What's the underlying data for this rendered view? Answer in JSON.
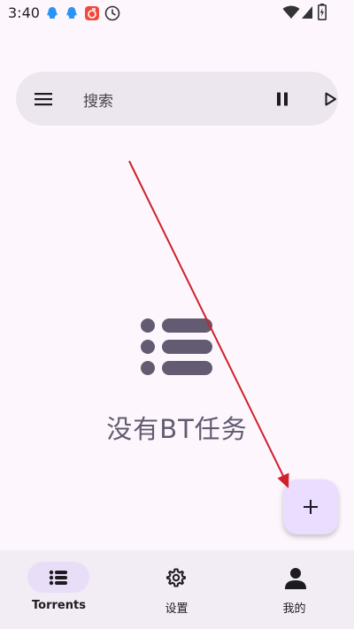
{
  "status_bar": {
    "time": "3:40",
    "notification_icons": [
      "qq-icon",
      "qq-icon",
      "music-app-icon",
      "clock-app-icon"
    ],
    "system_icons": [
      "wifi-icon",
      "signal-icon",
      "battery-icon"
    ]
  },
  "search_bar": {
    "placeholder": "搜索",
    "actions": [
      "pause-all",
      "resume-all"
    ]
  },
  "empty_state": {
    "message": "没有BT任务"
  },
  "fab": {
    "icon": "plus-icon"
  },
  "bottom_nav": {
    "items": [
      {
        "label": "Torrents",
        "icon": "list-icon",
        "active": true
      },
      {
        "label": "设置",
        "icon": "gear-icon",
        "active": false
      },
      {
        "label": "我的",
        "icon": "person-icon",
        "active": false
      }
    ]
  },
  "colors": {
    "background": "#fdf7fd",
    "search_bar": "#ece6ee",
    "accent": "#625b71",
    "fab": "#eaddff",
    "nav_background": "#f2ecf4",
    "nav_active_pill": "#e8def8",
    "annotation_arrow": "#d0202a"
  }
}
